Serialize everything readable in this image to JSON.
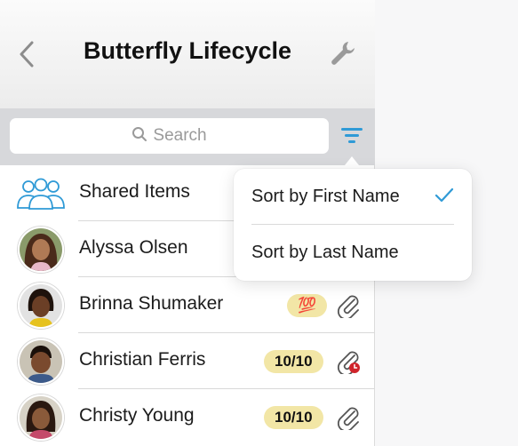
{
  "header": {
    "title": "Butterfly Lifecycle",
    "back_icon": "chevron-left-icon",
    "settings_icon": "wrench-icon"
  },
  "search": {
    "placeholder": "Search"
  },
  "list": {
    "shared": {
      "label": "Shared Items",
      "icon": "group-icon"
    },
    "students": [
      {
        "name": "Alyssa Olsen",
        "badge": "",
        "attachment": ""
      },
      {
        "name": "Brinna Shumaker",
        "badge": "💯",
        "attachment": "paperclip"
      },
      {
        "name": "Christian Ferris",
        "badge": "10/10",
        "attachment": "paperclip-clock"
      },
      {
        "name": "Christy Young",
        "badge": "10/10",
        "attachment": "paperclip"
      }
    ]
  },
  "sort_menu": {
    "options": [
      {
        "label": "Sort by First Name",
        "selected": true
      },
      {
        "label": "Sort by Last Name",
        "selected": false
      }
    ]
  },
  "colors": {
    "accent": "#2f9ad6",
    "badge_bg": "#f2e6a6",
    "alert": "#d0242b"
  }
}
